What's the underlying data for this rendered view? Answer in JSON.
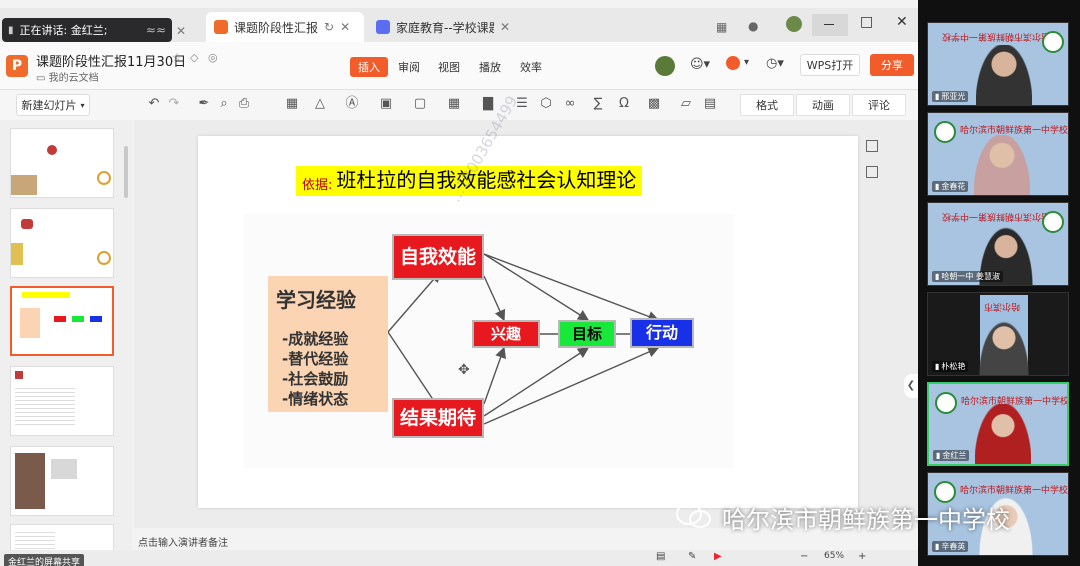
{
  "speaking_banner": "正在讲话: 金红兰;",
  "tabs": [
    {
      "label": "课题阶段性汇报"
    },
    {
      "label": "家庭教育--学校课题"
    }
  ],
  "doc": {
    "title": "课题阶段性汇报11月30日",
    "location": "我的云文档",
    "logo_letter": "P"
  },
  "menu": [
    "插入",
    "审阅",
    "视图",
    "播放",
    "效率"
  ],
  "header_buttons": {
    "wps_open": "WPS打开",
    "share": "分享"
  },
  "toolbar": {
    "new_slide": "新建幻灯片",
    "right_tabs": [
      "格式",
      "动画",
      "评论"
    ]
  },
  "slide": {
    "title_prefix": "依据:",
    "title": "班杜拉的自我效能感社会认知理论",
    "experience_title": "学习经验",
    "experience_items": [
      "-成就经验",
      "-替代经验",
      "-社会鼓励",
      "-情绪状态"
    ],
    "boxes": {
      "self_efficacy": "自我效能",
      "outcome_expectation": "结果期待",
      "interest": "兴趣",
      "goal": "目标",
      "action": "行动"
    },
    "watermark": "...18003654499"
  },
  "notes_placeholder": "点击输入演讲者备注",
  "share_label": "金红兰的屏幕共享",
  "zoom": "65%",
  "video_participants": [
    {
      "name": "邢亚光",
      "school": "哈尔滨市朝鲜族第一中学校"
    },
    {
      "name": "金春花",
      "school": "哈尔滨市朝鲜族第一中学校"
    },
    {
      "name": "哈朝一中 姜慧淑",
      "school": "哈尔滨市朝鲜族第一中学校"
    },
    {
      "name": "朴松艳",
      "school": "哈尔滨市"
    },
    {
      "name": "金红兰",
      "school": "哈尔滨市朝鲜族第一中学校"
    },
    {
      "name": "辛春英",
      "school": "哈尔滨市朝鲜族第一中学校"
    }
  ],
  "caption": "哈尔滨市朝鲜族第一中学校",
  "colors": {
    "accent": "#f25c2b",
    "red_box": "#e8181f",
    "green_box": "#18e83a",
    "blue_box": "#1830e8",
    "highlight": "#ffff00"
  }
}
